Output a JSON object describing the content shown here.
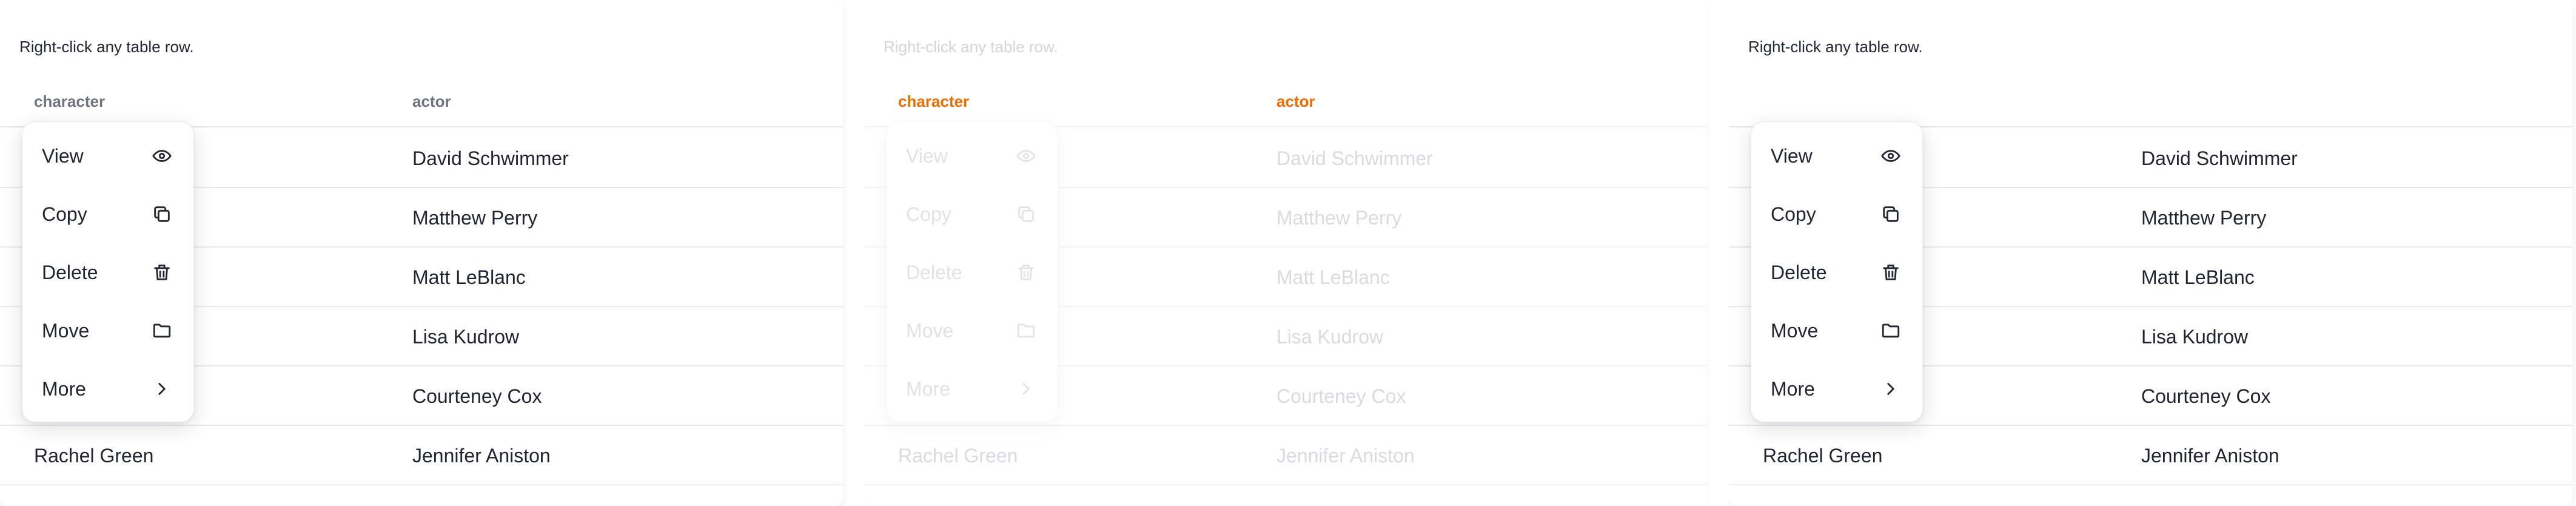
{
  "panels": [
    {
      "hint": "Right-click any table row.",
      "columns": [
        "character",
        "actor"
      ],
      "rows": [
        [
          "",
          "David Schwimmer"
        ],
        [
          "",
          "Matthew Perry"
        ],
        [
          "",
          "Matt LeBlanc"
        ],
        [
          "",
          "Lisa Kudrow"
        ],
        [
          "",
          "Courteney Cox"
        ],
        [
          "Rachel Green",
          "Jennifer Aniston"
        ]
      ],
      "menu": [
        {
          "label": "View",
          "icon": "eye-icon"
        },
        {
          "label": "Copy",
          "icon": "copy-icon"
        },
        {
          "label": "Delete",
          "icon": "trash-icon"
        },
        {
          "label": "Move",
          "icon": "folder-icon"
        },
        {
          "label": "More",
          "icon": "chevron-right-icon"
        }
      ]
    },
    {
      "hint": "Right-click any table row.",
      "columns": [
        "character",
        "actor"
      ],
      "rows": [
        [
          "",
          "David Schwimmer"
        ],
        [
          "",
          "Matthew Perry"
        ],
        [
          "",
          "Matt LeBlanc"
        ],
        [
          "",
          "Lisa Kudrow"
        ],
        [
          "",
          "Courteney Cox"
        ],
        [
          "Rachel Green",
          "Jennifer Aniston"
        ]
      ],
      "menu": [
        {
          "label": "View",
          "icon": "eye-icon"
        },
        {
          "label": "Copy",
          "icon": "copy-icon"
        },
        {
          "label": "Delete",
          "icon": "trash-icon"
        },
        {
          "label": "Move",
          "icon": "folder-icon"
        },
        {
          "label": "More",
          "icon": "chevron-right-icon"
        }
      ]
    },
    {
      "hint": "Right-click any table row.",
      "columns": [
        "",
        ""
      ],
      "rows": [
        [
          "",
          "David Schwimmer"
        ],
        [
          "",
          "Matthew Perry"
        ],
        [
          "",
          "Matt LeBlanc"
        ],
        [
          "",
          "Lisa Kudrow"
        ],
        [
          "",
          "Courteney Cox"
        ],
        [
          "Rachel Green",
          "Jennifer Aniston"
        ]
      ],
      "menu": [
        {
          "label": "View",
          "icon": "eye-icon"
        },
        {
          "label": "Copy",
          "icon": "copy-icon"
        },
        {
          "label": "Delete",
          "icon": "trash-icon"
        },
        {
          "label": "Move",
          "icon": "folder-icon"
        },
        {
          "label": "More",
          "icon": "chevron-right-icon"
        }
      ]
    }
  ],
  "colors": {
    "text": "#1f2430",
    "header_text": "#6f7380",
    "header_accent": "#ef6c00",
    "row_border": "#e7e9ee"
  }
}
